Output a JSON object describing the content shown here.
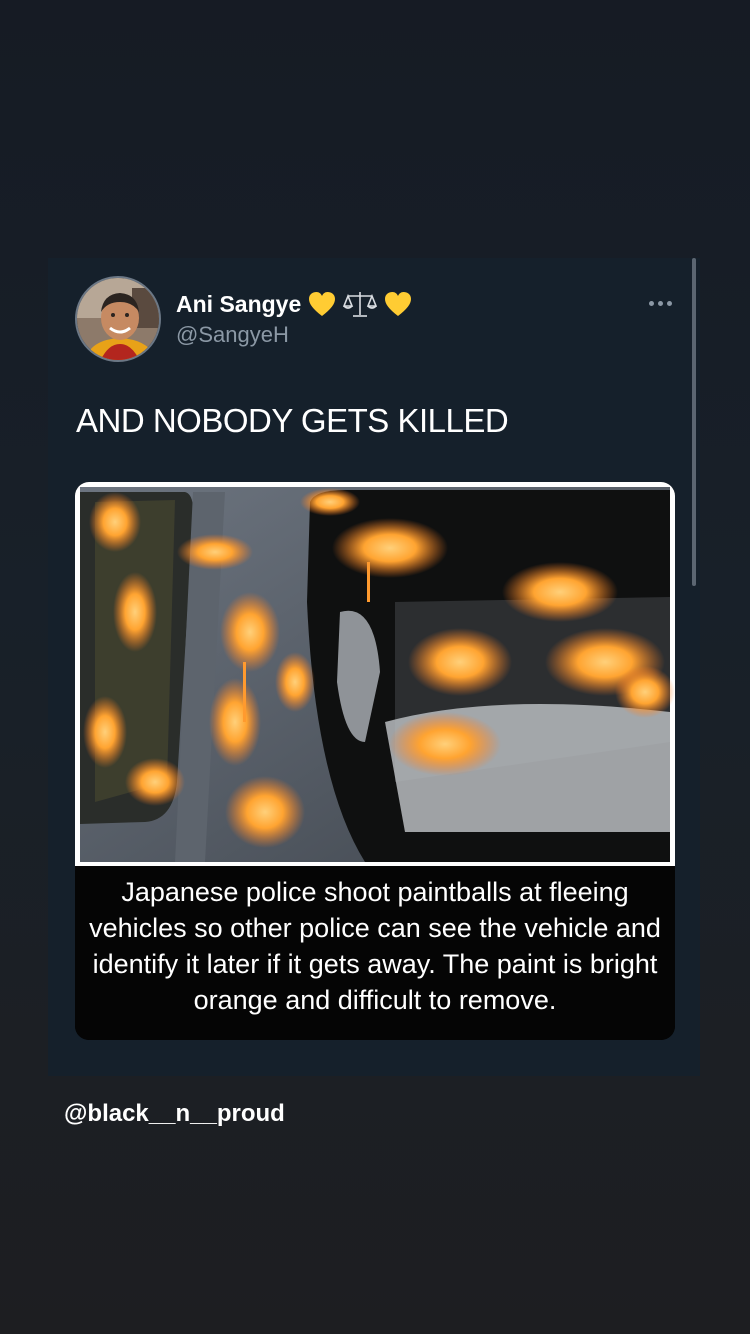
{
  "tweet": {
    "display_name": "Ani Sangye",
    "handle": "@SangyeH",
    "name_emojis": [
      "yellow-heart-icon",
      "balance-scale-icon",
      "yellow-heart-icon"
    ],
    "text": "AND NOBODY GETS KILLED",
    "more_icon": "more-options-icon"
  },
  "media": {
    "caption": "Japanese police shoot paintballs at fleeing vehicles so other police can see the vehicle and identify it later if it gets away. The paint is bright orange and difficult to remove."
  },
  "story": {
    "watermark": "@black__n__proud"
  },
  "colors": {
    "background": "#182029",
    "card": "#15202b",
    "paint_orange": "#ff8a2b",
    "secondary_text": "#8b98a5"
  }
}
